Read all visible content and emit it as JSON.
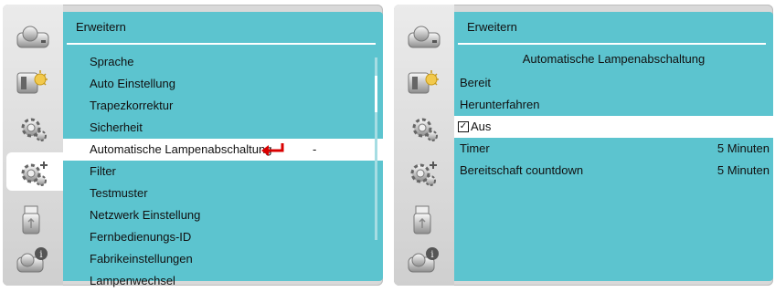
{
  "left_panel": {
    "header": "Erweitern",
    "items": [
      {
        "label": "Sprache"
      },
      {
        "label": "Auto Einstellung"
      },
      {
        "label": "Trapezkorrektur"
      },
      {
        "label": "Sicherheit"
      },
      {
        "label": "Automatische Lampenabschaltung",
        "dash": "-"
      },
      {
        "label": "Filter"
      },
      {
        "label": "Testmuster"
      },
      {
        "label": "Netzwerk Einstellung"
      },
      {
        "label": "Fernbedienungs-ID"
      },
      {
        "label": "Fabrikeinstellungen"
      },
      {
        "label": "Lampenwechsel"
      }
    ],
    "selected_index": 4
  },
  "right_panel": {
    "header": "Erweitern",
    "subtitle": "Automatische Lampenabschaltung",
    "options": [
      {
        "label": "Bereit"
      },
      {
        "label": "Herunterfahren"
      },
      {
        "label": "Aus",
        "checked": true
      }
    ],
    "settings": [
      {
        "label": "Timer",
        "value": "5 Minuten"
      },
      {
        "label": "Bereitschaft countdown",
        "value": "5 Minuten"
      }
    ]
  },
  "sidebar_icons": [
    "projector-icon",
    "image-icon",
    "gear-icon",
    "gear-plus-icon",
    "usb-icon",
    "info-icon"
  ],
  "selected_tab": "gear-plus-icon",
  "colors": {
    "content_bg": "#5cc4cf",
    "highlight": "#ffffff",
    "arrow": "#d90000"
  }
}
